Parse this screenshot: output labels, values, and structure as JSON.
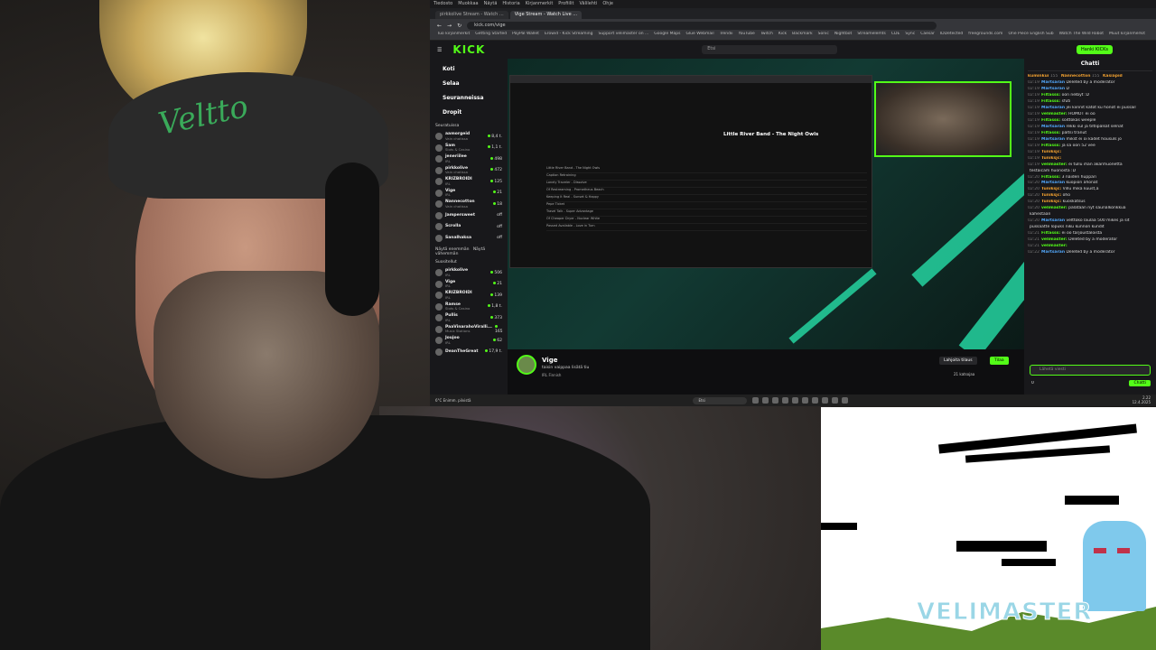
{
  "webcam": {
    "cap_text": "Veltto"
  },
  "browser": {
    "menu_items": [
      "Tiedosto",
      "Muokkaa",
      "Näytä",
      "Historia",
      "Kirjanmerkit",
      "Profiilit",
      "Välilehti",
      "Ohje"
    ],
    "tabs": [
      {
        "label": "pirkkolive Stream - Watch ..."
      },
      {
        "label": "Vige Stream - Watch Live ..."
      }
    ],
    "url": "kick.com/vige",
    "bookmarks": [
      "Tuo kirjanmerkit",
      "Getting Started",
      "PayPal Wallet",
      "Erowid - Kick Streaming",
      "Support velimaster on ...",
      "Google Maps",
      "Glue Webmail",
      "Trendii",
      "YouTube",
      "Twitch",
      "Kick",
      "Backmark",
      "Sonic",
      "Nightbot",
      "Streamelemts",
      "CDE",
      "Sync",
      "Caesar",
      "IDDetected",
      "freegrounds.com",
      "One Piece English Sub",
      "Watch The Wild Robot",
      "Muut kirjanmerkit"
    ]
  },
  "kick": {
    "logo": "KICK",
    "search_placeholder": "Etsi",
    "login_label": "Hanki KICKs",
    "nav": [
      "Koti",
      "Selaa",
      "Seuranneissa",
      "Dropit"
    ],
    "following_label": "Seuratuissa",
    "following": [
      {
        "name": "aamorgeid",
        "sub": "Vain chatissa",
        "count": "8,4 t."
      },
      {
        "name": "Sam",
        "sub": "Slots & Casino",
        "count": "1,1 t."
      },
      {
        "name": "jeneriilee",
        "sub": "IRL",
        "count": "498"
      },
      {
        "name": "pirkkolive",
        "sub": "Vain chatissa",
        "count": "472"
      },
      {
        "name": "KRIZBROIDI",
        "sub": "IRL",
        "count": "125"
      },
      {
        "name": "Vige",
        "sub": "IRL",
        "count": "21"
      },
      {
        "name": "Nannecotton",
        "sub": "Vain chatissa",
        "count": "18"
      },
      {
        "name": "Jampersweet",
        "sub": "",
        "count": "off"
      },
      {
        "name": "Scrolla",
        "sub": "",
        "count": "off"
      },
      {
        "name": "Sanalhaksa",
        "sub": "",
        "count": "off"
      }
    ],
    "show_more": "Näytä enemmän",
    "show_less": "Näytä vähemmän",
    "recommended_label": "Suositellut",
    "recommended": [
      {
        "name": "pirkkolive",
        "sub": "IRL",
        "count": "506"
      },
      {
        "name": "Vige",
        "sub": "IRL",
        "count": "21"
      },
      {
        "name": "KRIZBROIDI",
        "sub": "IRL",
        "count": "139"
      },
      {
        "name": "Ramse",
        "sub": "Slots & Casino",
        "count": "1,8 t."
      },
      {
        "name": "Pullis",
        "sub": "IRL",
        "count": "373"
      },
      {
        "name": "PaaVinarahoViralli...",
        "sub": "Music Stations",
        "count": "165"
      },
      {
        "name": "Joujoo",
        "sub": "IRL",
        "count": "62"
      },
      {
        "name": "DeanTheGreat",
        "sub": "",
        "count": "17,9 t."
      }
    ],
    "inner_song": "Little River Band - The Night Owls",
    "inner_rows": [
      "Little River Band - The Night Owls",
      "Caption Retraining",
      "Lonely Traveler - Dissolve",
      "Of Restreaming - Prometheus Beach",
      "Keeping It Real - Sunset & Happy",
      "Pepe Ticket",
      "Travel Talk - Super Advantage",
      "Of Cheaper Dryer - Nuclear White",
      "Passed Available - Love in Turn"
    ],
    "streamer_name": "Vige",
    "stream_title": "taisin vaippaa lisätä tiu",
    "stream_tags": "IRL  Finnish",
    "gift_label": "Lahjoita tilaus",
    "follow_label": "Tilaa",
    "viewer_count": "21 katsojaa",
    "chat_title": "Chatti",
    "chat_placeholder": "Lähetä viesti",
    "chat_button": "Chatti",
    "chat_points": "0",
    "chat_top": [
      {
        "name": "kuminkui",
        "count": "155"
      },
      {
        "name": "Nannecotton",
        "count": "155"
      },
      {
        "name": "Kasiapid",
        "count": ""
      }
    ],
    "chat": [
      {
        "t": "02:19",
        "u": "Martsaran",
        "c": "",
        "m": "Deleted by a moderator"
      },
      {
        "t": "02:19",
        "u": "Martsaran",
        "c": "",
        "m": "D"
      },
      {
        "t": "02:19",
        "u": "Filtasss:",
        "c": "g",
        "m": "oon nelbyt :D"
      },
      {
        "t": "02:19",
        "u": "Filtasss:",
        "c": "g",
        "m": "sfuti"
      },
      {
        "t": "02:19",
        "u": "Martsaran",
        "c": "",
        "m": "jei kiinnit katot ku honot ei pussail"
      },
      {
        "t": "02:19",
        "u": "velimaster:",
        "c": "g",
        "m": "HOMOT ei oo"
      },
      {
        "t": "02:19",
        "u": "Filtasss:",
        "c": "g",
        "m": "soittokas weeple"
      },
      {
        "t": "02:19",
        "u": "Martsaran",
        "c": "",
        "m": "rekki sul ja tiltlipalsat selnät"
      },
      {
        "t": "02:19",
        "u": "Filtasss:",
        "c": "g",
        "m": "paltsi tranut"
      },
      {
        "t": "02:19",
        "u": "Martsaran",
        "c": "",
        "m": "mikst ei oi kädet housuls jo"
      },
      {
        "t": "02:19",
        "u": "Filtasss:",
        "c": "g",
        "m": "ja sä oon 52 vee"
      },
      {
        "t": "02:19",
        "u": "Tuniksjc:",
        "c": "o",
        "m": ""
      },
      {
        "t": "02:19",
        "u": "Tuniksjc:",
        "c": "o",
        "m": ""
      },
      {
        "t": "02:19",
        "u": "velimaster:",
        "c": "g",
        "m": "ei tullu ihan akarihuonetta"
      },
      {
        "t": "",
        "u": "",
        "c": "",
        "m": "testaicam huonosta :D"
      },
      {
        "t": "02:20",
        "u": "Filtasss:",
        "c": "g",
        "m": "3 naiden huppari"
      },
      {
        "t": "02:20",
        "u": "Martsaran",
        "c": "",
        "m": "kuopion ahonat"
      },
      {
        "t": "02:20",
        "u": "Tuniksjc:",
        "c": "o",
        "m": "Villu mikä kuust,a"
      },
      {
        "t": "02:20",
        "u": "Tuniksjc:",
        "c": "o",
        "m": "oho"
      },
      {
        "t": "02:20",
        "u": "Tuniksjc:",
        "c": "o",
        "m": "kuoskatsus"
      },
      {
        "t": "02:20",
        "u": "velimaster:",
        "c": "g",
        "m": "palataan nyt saunalkonkkua"
      },
      {
        "t": "",
        "u": "",
        "c": "",
        "m": "kahestaan"
      },
      {
        "t": "02:20",
        "u": "Martsaran",
        "c": "",
        "m": "velttoko laulaa 500 mikes ja sit"
      },
      {
        "t": "",
        "u": "",
        "c": "",
        "m": "pussaatte lopuks niku kunnon kundit"
      },
      {
        "t": "02:21",
        "u": "Filtasss:",
        "c": "g",
        "m": "ei oo tarjoustaloista"
      },
      {
        "t": "02:21",
        "u": "velimaster:",
        "c": "g",
        "m": "Deleted by a moderator"
      },
      {
        "t": "02:21",
        "u": "velimaster:",
        "c": "g",
        "m": ""
      },
      {
        "t": "02:22",
        "u": "Martsaran",
        "c": "",
        "m": "Deleted by a moderator"
      }
    ]
  },
  "taskbar": {
    "weather": "6°C Enimm. pilvistä",
    "search": "Etsi",
    "time": "2.22",
    "date": "12.4.2025"
  },
  "overlay": {
    "logo_text": "VELIMASTER"
  }
}
